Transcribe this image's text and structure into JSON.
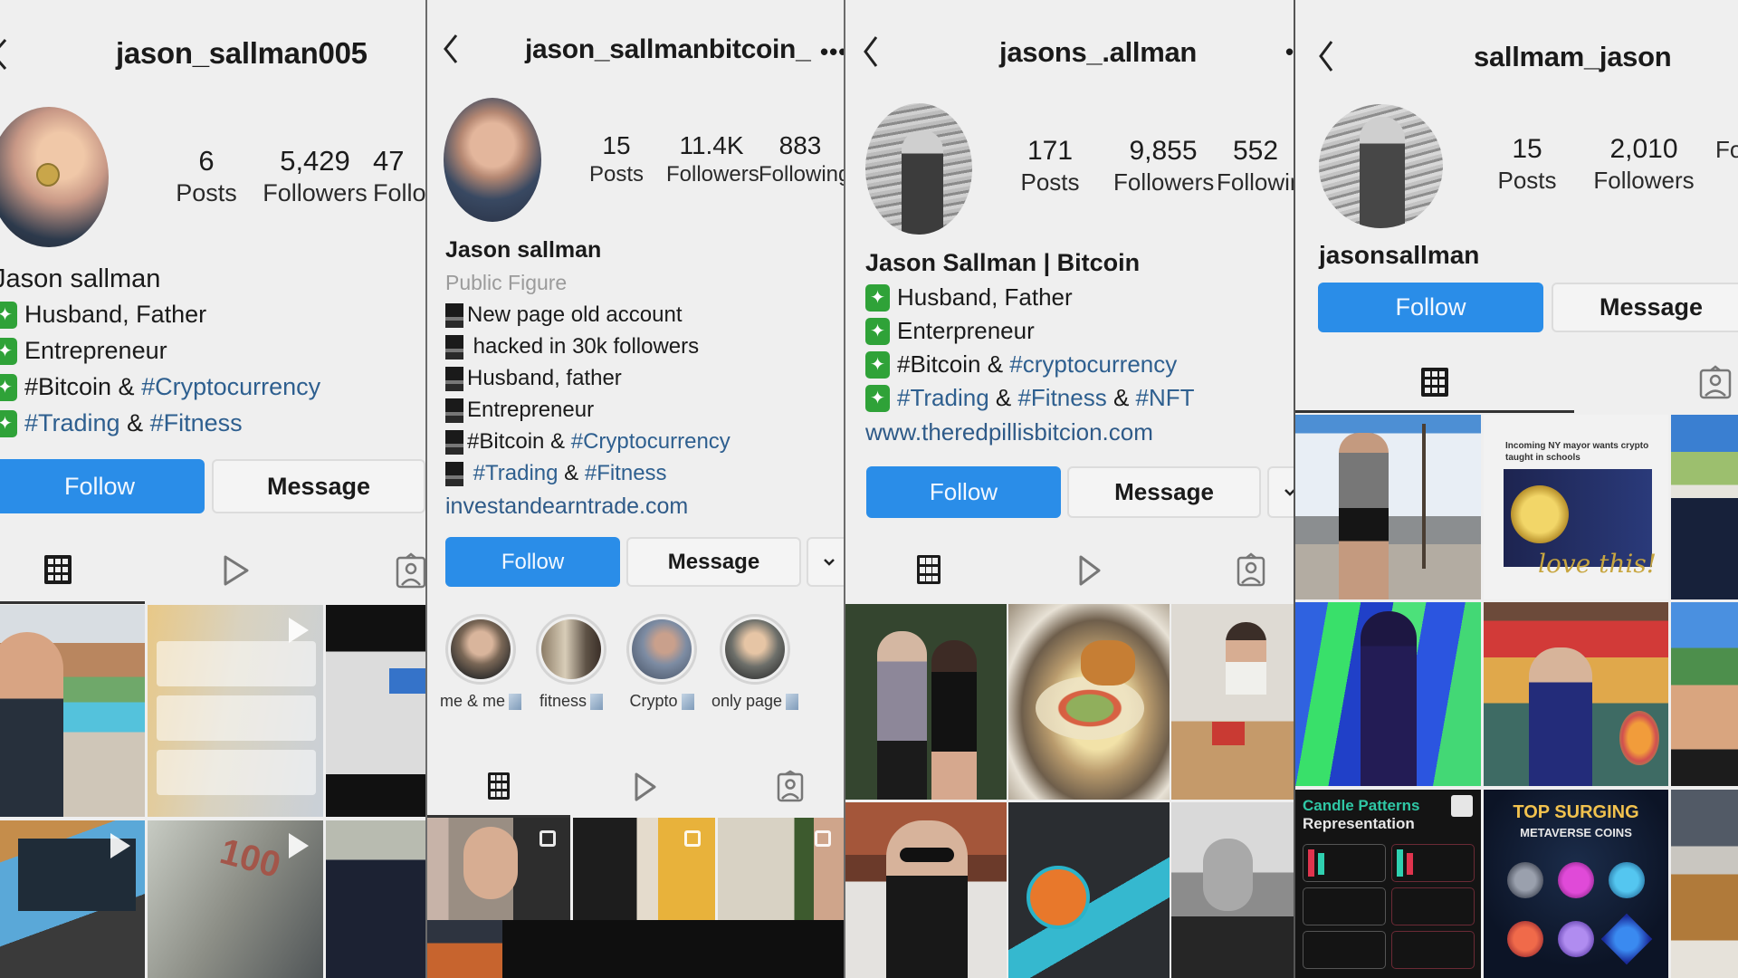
{
  "panels": [
    {
      "username": "jason_sallman005",
      "stats": [
        {
          "value": "6",
          "label": "Posts"
        },
        {
          "value": "5,429",
          "label": "Followers"
        },
        {
          "value": "47",
          "label": "Follo"
        }
      ],
      "display_name": "Jason sallman",
      "bio_icon": "green-sparkle-emoji",
      "bio": [
        {
          "plain": "Husband, Father"
        },
        {
          "plain": "Entrepreneur"
        },
        {
          "plain": "#Bitcoin & ",
          "tag": "#Cryptocurrency"
        },
        {
          "tag": "#Trading",
          "plain2": " & ",
          "tag2": "#Fitness"
        }
      ],
      "follow_label": "Follow",
      "message_label": "Message",
      "tabs": [
        "grid-icon",
        "reels-icon",
        "tagged-icon"
      ],
      "grid": [
        {
          "desc": "selfie at resort pool",
          "video": false
        },
        {
          "desc": "blockchain payment notifications",
          "video": true
        },
        {
          "desc": "TikTok screenshot",
          "video": false
        },
        {
          "desc": "trading charts on laptop",
          "video": true
        },
        {
          "desc": "stack of 100 dollar bills",
          "video": true
        },
        {
          "desc": "man in dark jacket",
          "video": false
        }
      ]
    },
    {
      "username": "jason_sallmanbitcoin_",
      "more_label": "•••",
      "stats": [
        {
          "value": "15",
          "label": "Posts"
        },
        {
          "value": "11.4K",
          "label": "Followers"
        },
        {
          "value": "883",
          "label": "Following"
        }
      ],
      "display_name": "Jason sallman",
      "category": "Public Figure",
      "bio_icon": "black-square-emoji",
      "bio": [
        {
          "plain": "New page old account"
        },
        {
          "plain": " hacked in 30k followers"
        },
        {
          "plain": "Husband, father"
        },
        {
          "plain": "Entrepreneur"
        },
        {
          "plain": "#Bitcoin & ",
          "tag": "#Cryptocurrency"
        },
        {
          "tag": " #Trading",
          "plain2": " & ",
          "tag2": "#Fitness"
        }
      ],
      "website": "investandearntrade.com",
      "follow_label": "Follow",
      "message_label": "Message",
      "dropdown_label": "˅",
      "highlights": [
        {
          "label": "me & me"
        },
        {
          "label": "fitness"
        },
        {
          "label": "Crypto"
        },
        {
          "label": "only page"
        }
      ],
      "tabs": [
        "grid-icon",
        "reels-icon",
        "tagged-icon"
      ],
      "grid": [
        {
          "desc": "man with headphones at microphone",
          "video": false
        },
        {
          "desc": "man holding gold bitcoin",
          "video": false
        },
        {
          "desc": "man in sunglasses outdoors",
          "video": false
        }
      ]
    },
    {
      "username": "jasons_.allman",
      "stats": [
        {
          "value": "171",
          "label": "Posts"
        },
        {
          "value": "9,855",
          "label": "Followers"
        },
        {
          "value": "552",
          "label": "Followin"
        }
      ],
      "display_name": "Jason Sallman | Bitcoin",
      "bio_icon": "green-sparkle-emoji",
      "bio": [
        {
          "plain": "Husband, Father"
        },
        {
          "plain": "Enterpreneur"
        },
        {
          "plain": "#Bitcoin & ",
          "tag": "#cryptocurrency"
        },
        {
          "tag": "#Trading",
          "plain2": " & ",
          "tag2": "#Fitness",
          "plain3": " & ",
          "tag3": "#NFT"
        }
      ],
      "website": "www.theredpillisbitcion.com",
      "follow_label": "Follow",
      "message_label": "Message",
      "tabs": [
        "grid-icon",
        "reels-icon",
        "tagged-icon"
      ],
      "grid": [
        {
          "desc": "couple at party with crown"
        },
        {
          "desc": "tacos with fries"
        },
        {
          "desc": "man with cardboard box"
        },
        {
          "desc": "man in sunglasses and blazer"
        },
        {
          "desc": "Toughest Mudder medal"
        },
        {
          "desc": "black and white portrait"
        }
      ]
    },
    {
      "username": "sallmam_jason",
      "stats": [
        {
          "value": "15",
          "label": "Posts"
        },
        {
          "value": "2,010",
          "label": "Followers"
        },
        {
          "value": "",
          "label": "Fo"
        }
      ],
      "display_name": "jasonsallman",
      "follow_label": "Follow",
      "message_label": "Message",
      "tabs": [
        "grid-icon",
        "tagged-icon"
      ],
      "grid": [
        {
          "desc": "man standing near ship mast"
        },
        {
          "desc": "news card",
          "headline": "Incoming NY mayor wants crypto taught in schools",
          "overlay": "love this!"
        },
        {
          "desc": "close-up selfie"
        },
        {
          "desc": "man in neon jungle room"
        },
        {
          "desc": "man in neon lit lobby"
        },
        {
          "desc": "arm flex outdoors"
        },
        {
          "desc": "infographic",
          "line1": "Candle Patterns",
          "line2": "Representation"
        },
        {
          "desc": "infographic",
          "line1": "TOP SURGING",
          "line2": "METAVERSE COINS"
        },
        {
          "desc": "glass of drink"
        }
      ]
    }
  ],
  "colors": {
    "follow_blue": "#2a8de8",
    "hashtag_blue": "#2e5f8f",
    "sparkle_green": "#2fa238",
    "background": "#efefef"
  }
}
